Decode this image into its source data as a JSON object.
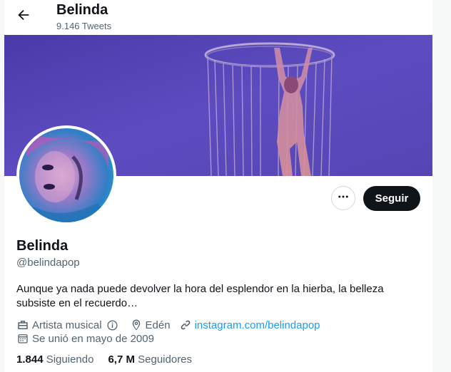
{
  "header": {
    "title": "Belinda",
    "tweet_count": "9.146 Tweets"
  },
  "profile": {
    "name": "Belinda",
    "handle": "@belindapop",
    "bio": "Aunque ya nada puede devolver la hora del esplendor en la hierba, la belleza subsiste en el recuerdo…",
    "category": "Artista musical",
    "location": "Edén",
    "website": "instagram.com/belindapop",
    "joined": "Se unió en mayo de 2009"
  },
  "actions": {
    "follow_label": "Seguir"
  },
  "stats": {
    "following_count": "1.844",
    "following_label": "Siguiendo",
    "followers_count": "6,7 M",
    "followers_label": "Seguidores"
  },
  "icons": {
    "back": "arrow-left-icon",
    "more": "more-dots-icon",
    "category": "briefcase-icon",
    "info": "info-icon",
    "location": "location-pin-icon",
    "website": "link-icon",
    "joined": "calendar-icon"
  },
  "colors": {
    "link": "#1d9bf0",
    "follow_button": "#0f1419",
    "secondary_text": "#536471",
    "banner": "#5a48b8"
  }
}
